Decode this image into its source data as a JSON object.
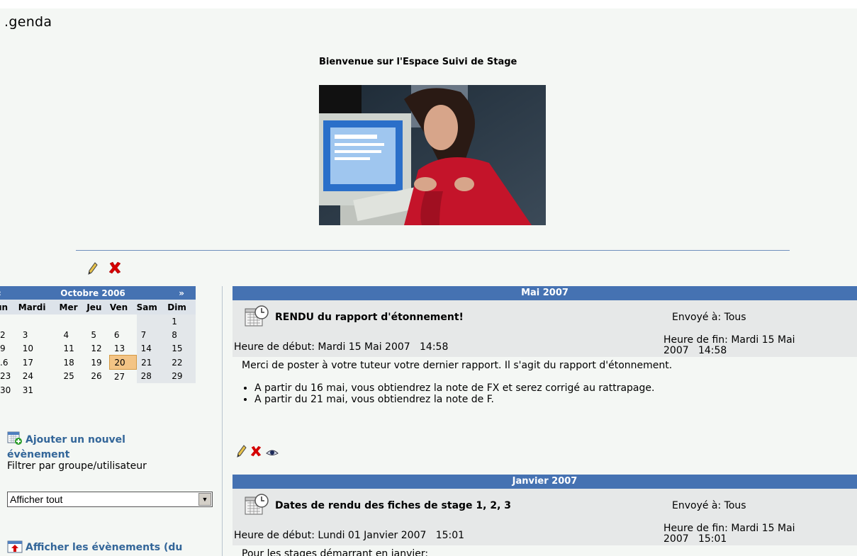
{
  "page": {
    "title": ".genda"
  },
  "header": {
    "welcome": "Bienvenue sur l'Espace Suivi de Stage"
  },
  "calendar": {
    "prev": "«",
    "month": "Octobre 2006",
    "next": "»",
    "weekdays": [
      "un",
      "Mardi",
      "Mer",
      "Jeu",
      "Ven",
      "Sam",
      "Dim"
    ],
    "weeks": [
      [
        "",
        "",
        "",
        "",
        "",
        "",
        "1"
      ],
      [
        "2",
        "3",
        "4",
        "5",
        "6",
        "7",
        "8"
      ],
      [
        "9",
        "10",
        "11",
        "12",
        "13",
        "14",
        "15"
      ],
      [
        ".6",
        "17",
        "18",
        "19",
        "20",
        "21",
        "22"
      ],
      [
        "23",
        "24",
        "25",
        "26",
        "27",
        "28",
        "29"
      ],
      [
        "30",
        "31",
        "",
        "",
        "",
        "",
        ""
      ]
    ],
    "today": "20"
  },
  "sidebar": {
    "add_event": "Ajouter un nouvel évènement",
    "filter_label": "Filtrer par groupe/utilisateur",
    "filter_value": "Afficher tout",
    "show_events": "Afficher les évènements (du"
  },
  "events": [
    {
      "month": "Mai 2007",
      "title": "RENDU du rapport d'étonnement!",
      "sent_to": "Envoyé à: Tous",
      "start": "Heure de début: Mardi 15 Mai 2007   14:58",
      "end": "Heure de fin: Mardi 15 Mai\n2007   14:58",
      "body": "Merci de poster à votre tuteur votre dernier rapport. Il s'agit du rapport d'étonnement.",
      "bullets": [
        "A partir du 16 mai, vous obtiendrez la note de FX et serez corrigé au rattrapage.",
        "A partir du 21 mai, vous obtiendrez la note de F."
      ]
    },
    {
      "month": "Janvier 2007",
      "title": "Dates de rendu des fiches de stage 1, 2, 3",
      "sent_to": "Envoyé à: Tous",
      "start": "Heure de début: Lundi 01 Janvier 2007   15:01",
      "end": "Heure de fin: Mardi 15 Mai\n2007   15:01",
      "body": "Pour les stages démarrant en janvier:"
    }
  ]
}
